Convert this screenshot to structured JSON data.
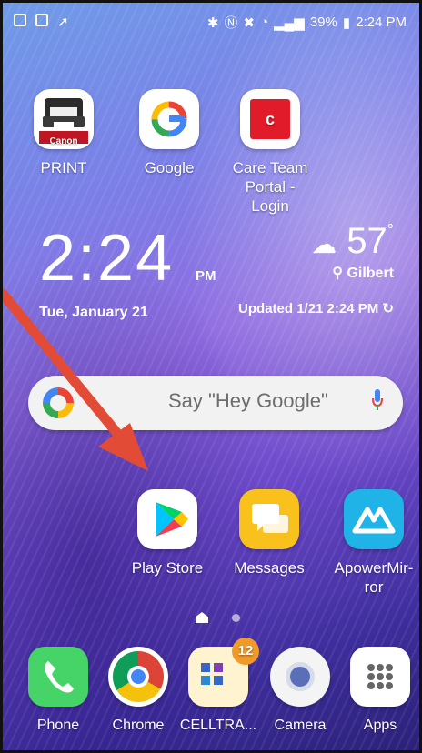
{
  "status": {
    "battery": "39%",
    "time": "2:24 PM"
  },
  "home": {
    "apps_row1": [
      {
        "label": "PRINT",
        "icon": "canon-print-icon",
        "brand_text": "Canon"
      },
      {
        "label": "Google",
        "icon": "google-icon"
      },
      {
        "label": "Care Team\nPortal - Login",
        "icon": "care-team-icon",
        "glyph": "c"
      }
    ],
    "clock": {
      "time": "2:24",
      "ampm": "PM",
      "date": "Tue, January 21"
    },
    "weather": {
      "temp": "57",
      "location": "Gilbert",
      "updated": "Updated 1/21 2:24 PM"
    },
    "search": {
      "placeholder": "Say \"Hey Google\""
    },
    "apps_row2": [
      {
        "label": "Play Store",
        "icon": "play-store-icon"
      },
      {
        "label": "Messages",
        "icon": "messages-icon"
      },
      {
        "label": "ApowerMir-\nror",
        "icon": "apowermirror-icon"
      }
    ],
    "dock": [
      {
        "label": "Phone",
        "icon": "phone-icon"
      },
      {
        "label": "Chrome",
        "icon": "chrome-icon"
      },
      {
        "label": "CELLTRA...",
        "icon": "folder-icon",
        "badge": "12"
      },
      {
        "label": "Camera",
        "icon": "camera-icon"
      },
      {
        "label": "Apps",
        "icon": "apps-grid-icon"
      }
    ]
  },
  "colors": {
    "arrow": "#e24b36"
  }
}
